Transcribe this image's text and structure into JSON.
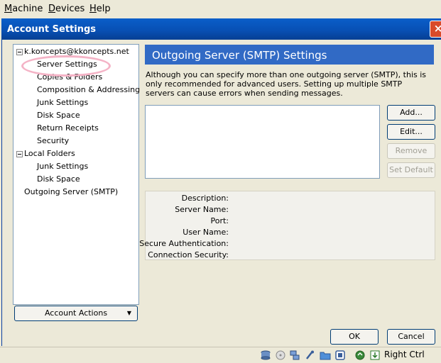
{
  "menubar": {
    "items": [
      {
        "label": "Machine",
        "underline": "M",
        "rest": "achine"
      },
      {
        "label": "Devices",
        "underline": "D",
        "rest": "evices"
      },
      {
        "label": "Help",
        "underline": "H",
        "rest": "elp"
      }
    ]
  },
  "dialog": {
    "title": "Account Settings",
    "close": "×"
  },
  "tree": {
    "account": "k.koncepts@kkoncepts.net",
    "account_children": [
      "Server Settings",
      "Copies & Folders",
      "Composition & Addressing",
      "Junk Settings",
      "Disk Space",
      "Return Receipts",
      "Security"
    ],
    "local_folders": "Local Folders",
    "local_children": [
      "Junk Settings",
      "Disk Space"
    ],
    "outgoing": "Outgoing Server (SMTP)"
  },
  "account_actions": {
    "label": "Account Actions",
    "arrow": "▼"
  },
  "panel": {
    "header": "Outgoing Server (SMTP) Settings",
    "description": "Although you can specify more than one outgoing server (SMTP), this is only recommended for advanced users. Setting up multiple SMTP servers can cause errors when sending messages.",
    "buttons": {
      "add": "Add...",
      "edit": "Edit...",
      "remove": "Remove",
      "set_default": "Set Default"
    },
    "details": {
      "description": "Description:",
      "server_name": "Server Name:",
      "port": "Port:",
      "user_name": "User Name:",
      "secure_auth": "Secure Authentication:",
      "conn_security": "Connection Security:"
    }
  },
  "footer": {
    "ok": "OK",
    "cancel": "Cancel"
  },
  "statusbar": {
    "host_key": "Right Ctrl",
    "icons": [
      "hard-disk-icon",
      "optical-drive-icon",
      "network-icon",
      "usb-icon",
      "shared-folder-icon",
      "display-icon",
      "mouse-integration-icon",
      "host-key-icon"
    ]
  }
}
